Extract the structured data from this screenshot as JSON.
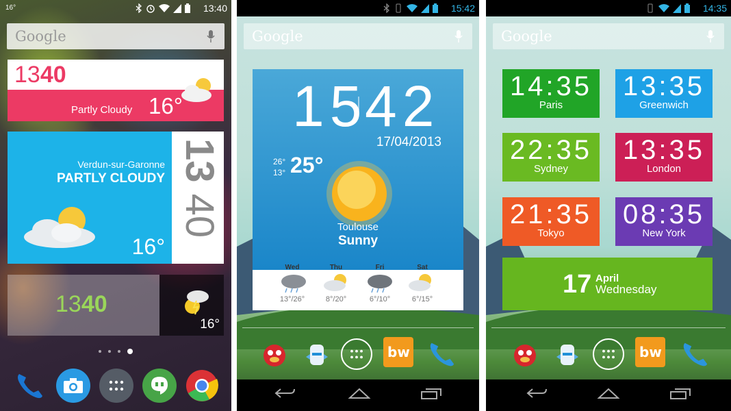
{
  "phone1": {
    "status": {
      "left_temp": "16°",
      "time": "13:40"
    },
    "search": {
      "logo": "Google"
    },
    "widget_pink": {
      "hours": "13",
      "minutes": "40",
      "condition": "Partly Cloudy",
      "temperature": "16°"
    },
    "widget_blue": {
      "city": "Verdun-sur-Garonne",
      "condition": "PARTLY CLOUDY",
      "temperature": "16°",
      "hours": "13",
      "minutes": "40"
    },
    "widget_glass": {
      "hours": "13",
      "minutes": "40",
      "temperature": "16°"
    },
    "dock": [
      "phone-icon",
      "camera-icon",
      "apps-icon",
      "hangouts-icon",
      "chrome-icon"
    ]
  },
  "phone2": {
    "status": {
      "time": "15:42"
    },
    "search": {
      "logo": "Google"
    },
    "widget": {
      "hours": "15",
      "minutes": "42",
      "date": "17/04/2013",
      "high": "26°",
      "low": "13°",
      "now": "25°",
      "city": "Toulouse",
      "condition": "Sunny",
      "forecast": [
        {
          "day": "Wed",
          "temps": "13°/26°"
        },
        {
          "day": "Thu",
          "temps": "8°/20°"
        },
        {
          "day": "Fri",
          "temps": "6°/10°"
        },
        {
          "day": "Sat",
          "temps": "6°/15°"
        }
      ]
    }
  },
  "phone3": {
    "status": {
      "time": "14:35"
    },
    "search": {
      "logo": "Google"
    },
    "tiles": [
      {
        "time": "14:35",
        "city": "Paris",
        "color": "#21a527"
      },
      {
        "time": "13:35",
        "city": "Greenwich",
        "color": "#1ea1e6"
      },
      {
        "time": "22:35",
        "city": "Sydney",
        "color": "#6aba22"
      },
      {
        "time": "13:35",
        "city": "London",
        "color": "#cc1f56"
      },
      {
        "time": "21:35",
        "city": "Tokyo",
        "color": "#ef5a26"
      },
      {
        "time": "08:35",
        "city": "New York",
        "color": "#6b3bb3"
      }
    ],
    "date": {
      "day": "17",
      "month": "April",
      "weekday": "Wednesday"
    }
  }
}
